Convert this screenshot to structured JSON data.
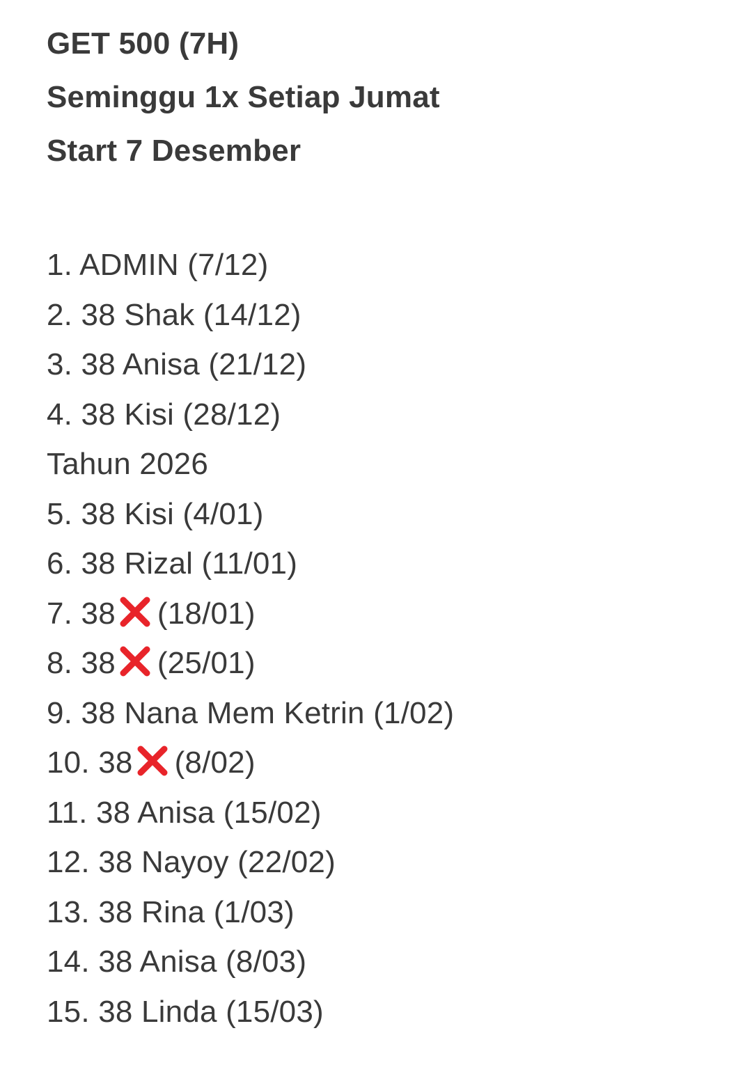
{
  "header": {
    "title": "GET 500 (7H)",
    "schedule": "Seminggu 1x Setiap Jumat",
    "start": "Start 7 Desember"
  },
  "list": {
    "items": [
      {
        "number": "1.",
        "text": "ADMIN (7/12)"
      },
      {
        "number": "2.",
        "text": "38 Shak (14/12)"
      },
      {
        "number": "3.",
        "text": "38 Anisa (21/12)"
      },
      {
        "number": "4.",
        "text": "38 Kisi (28/12)"
      },
      {
        "section": "Tahun 2026"
      },
      {
        "number": "5.",
        "text": "38 Kisi (4/01)"
      },
      {
        "number": "6.",
        "text": "38 Rizal (11/01)"
      },
      {
        "number": "7.",
        "prefix": "38",
        "icon": "cross-mark-icon",
        "suffix": "(18/01)"
      },
      {
        "number": "8.",
        "prefix": "38",
        "icon": "cross-mark-icon",
        "suffix": "(25/01)"
      },
      {
        "number": "9.",
        "text": "38 Nana Mem Ketrin (1/02)"
      },
      {
        "number": "10.",
        "prefix": "38",
        "icon": "cross-mark-icon",
        "suffix": "(8/02)"
      },
      {
        "number": "11.",
        "text": "38 Anisa (15/02)"
      },
      {
        "number": "12.",
        "text": "38 Nayoy (22/02)"
      },
      {
        "number": "13.",
        "text": "38 Rina (1/03)"
      },
      {
        "number": "14.",
        "text": "38 Anisa (8/03)"
      },
      {
        "number": "15.",
        "text": "38 Linda (15/03)"
      }
    ]
  },
  "colors": {
    "text": "#3a3a3a",
    "cross": "#e8242a",
    "background": "#ffffff"
  }
}
